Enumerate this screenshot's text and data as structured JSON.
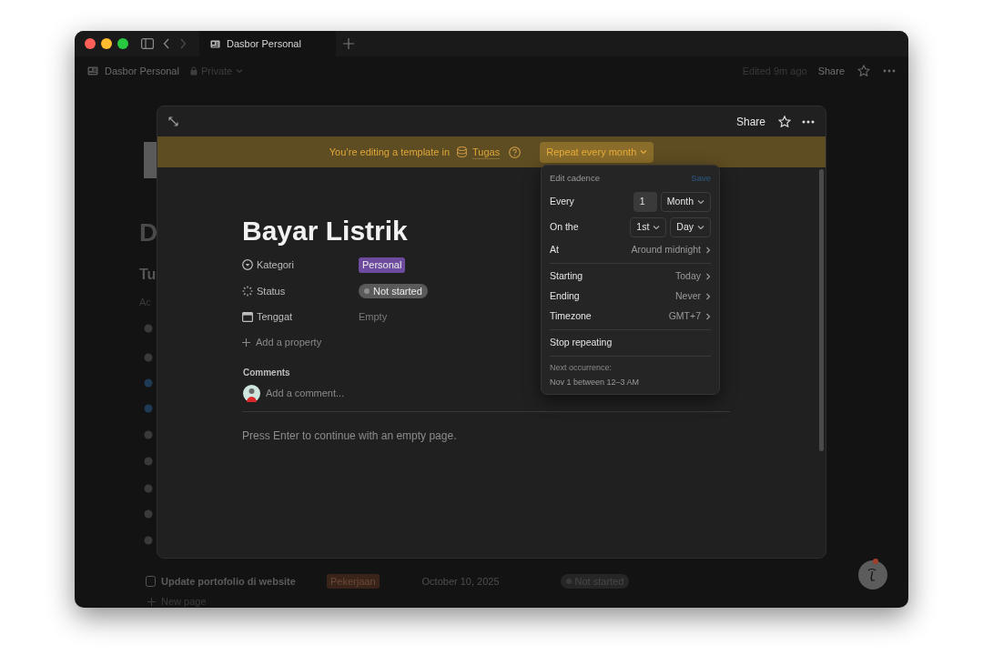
{
  "window": {
    "tabs": [
      {
        "title": "Dasbor Personal",
        "selected": true
      }
    ]
  },
  "breadcrumb": {
    "page": "Dasbor Personal",
    "privacy": "Private",
    "edited": "Edited 9m ago",
    "share": "Share"
  },
  "background": {
    "fragments": [
      {
        "kind": "heading",
        "text": "D"
      },
      {
        "kind": "subheading",
        "text": "Tu"
      },
      {
        "kind": "label",
        "text": "Ac"
      }
    ],
    "row": {
      "title": "Update portofolio di website",
      "tag": "Pekerjaan",
      "date": "October 10, 2025",
      "status": "Not started"
    },
    "new_page": "New page"
  },
  "modal": {
    "share": "Share",
    "banner": {
      "text": "You’re editing a template in",
      "database": "Tugas",
      "repeat": "Repeat every month"
    },
    "title": "Bayar Listrik",
    "properties": [
      {
        "kind": "select",
        "name": "Kategori",
        "value": "Personal",
        "color": "#6d4c9f"
      },
      {
        "kind": "status",
        "name": "Status",
        "value": "Not started"
      },
      {
        "kind": "date",
        "name": "Tenggat",
        "value": "Empty"
      }
    ],
    "add_property": "Add a property",
    "comments": {
      "heading": "Comments",
      "placeholder": "Add a comment..."
    },
    "hint": "Press Enter to continue with an empty page."
  },
  "cadence": {
    "title": "Edit cadence",
    "save": {
      "label": "Save",
      "disabled": true
    },
    "groups": [
      [
        {
          "kind": "field",
          "label": "Every",
          "value": "1",
          "unit": "Month"
        },
        {
          "kind": "dropdowns",
          "label": "On the",
          "options": [
            "1st",
            "Day"
          ]
        },
        {
          "kind": "link",
          "label": "At",
          "value": "Around midnight"
        }
      ],
      [
        {
          "kind": "link",
          "label": "Starting",
          "value": "Today"
        },
        {
          "kind": "link",
          "label": "Ending",
          "value": "Never"
        },
        {
          "kind": "link",
          "label": "Timezone",
          "value": "GMT+7"
        }
      ],
      [
        {
          "kind": "action",
          "label": "Stop repeating"
        }
      ]
    ],
    "next": {
      "label": "Next occurrence:",
      "value": "Nov 1 between 12–3 AM"
    }
  }
}
